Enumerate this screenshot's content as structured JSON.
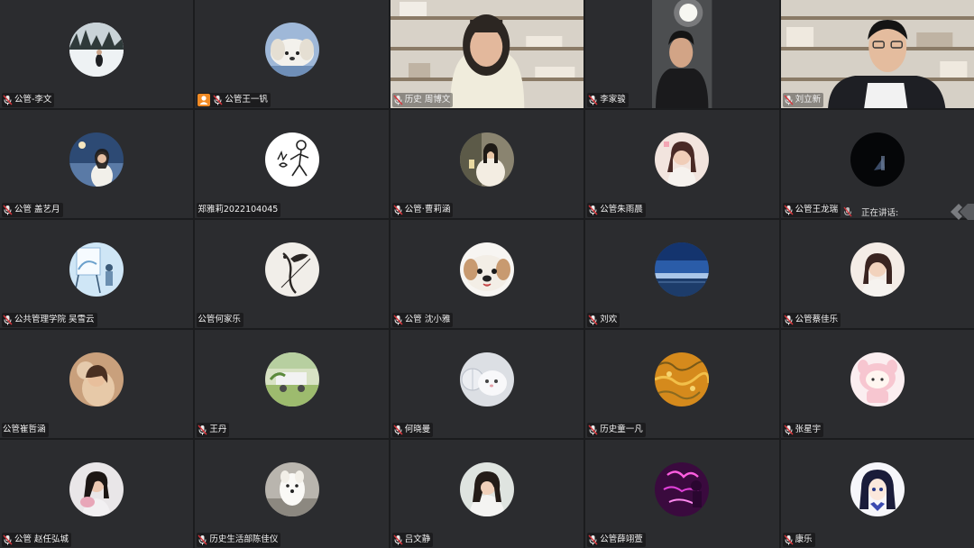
{
  "participants": [
    {
      "name": "公管-李文",
      "mic": true
    },
    {
      "name": "公管王一钒",
      "mic": true,
      "user_badge": true
    },
    {
      "name": "历史 周博文",
      "mic": true,
      "video": true
    },
    {
      "name": "李家骏",
      "mic": true,
      "video": true
    },
    {
      "name": "刘立新",
      "mic": true,
      "video": true
    },
    {
      "name": "公管 盖艺月",
      "mic": true
    },
    {
      "name": "郑雅莉2022104045",
      "mic": false
    },
    {
      "name": "公管·曹莉涵",
      "mic": true
    },
    {
      "name": "公管朱雨晨",
      "mic": true
    },
    {
      "name": "公管王龙瑞",
      "mic": true
    },
    {
      "name": "公共管理学院 吴雪云",
      "mic": true
    },
    {
      "name": "公管何家乐",
      "mic": false
    },
    {
      "name": "公管 沈小雅",
      "mic": true
    },
    {
      "name": "刘欢",
      "mic": true
    },
    {
      "name": "公管蔡佳乐",
      "mic": true
    },
    {
      "name": "公管崔哲涵",
      "mic": false
    },
    {
      "name": "王丹",
      "mic": true
    },
    {
      "name": "何晓曼",
      "mic": true
    },
    {
      "name": "历史童一凡",
      "mic": true
    },
    {
      "name": "张星宇",
      "mic": true
    },
    {
      "name": "公管 赵任弘城",
      "mic": true
    },
    {
      "name": "历史生活部陈佳仪",
      "mic": true
    },
    {
      "name": "吕文静",
      "mic": true
    },
    {
      "name": "公管薛翊萱",
      "mic": true
    },
    {
      "name": "康乐",
      "mic": true
    }
  ],
  "speaking_indicator": {
    "label": "正在讲话:"
  },
  "icons": {
    "mic": "microphone-muted-icon",
    "user": "user-icon",
    "collapse": "collapse-panel-icon"
  },
  "colors": {
    "tile_bg": "#2b2c2f",
    "grid_bg": "#1b1c1e",
    "mic_red": "#d9343a",
    "badge_orange": "#f08a24"
  }
}
